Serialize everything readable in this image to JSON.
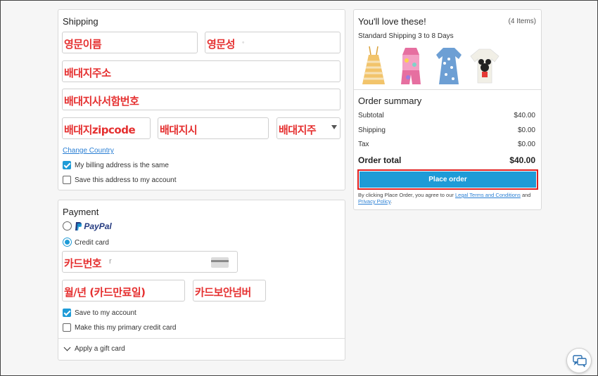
{
  "shipping": {
    "title": "Shipping",
    "first_name_overlay": "영문이름",
    "last_name_overlay": "영문성",
    "address_overlay": "배대지주소",
    "address2_overlay": "배대지사서함번호",
    "zip_overlay": "배대지zipcode",
    "city_overlay": "배대지시",
    "state_overlay": "배대지주",
    "change_country": "Change Country",
    "billing_same_label": "My billing address is the same",
    "billing_same_checked": true,
    "save_address_label": "Save this address to my account",
    "save_address_checked": false
  },
  "payment": {
    "title": "Payment",
    "paypal_label": "PayPal",
    "credit_card_label": "Credit card",
    "card_number_overlay": "카드번호",
    "card_number_placeholder_tail": "r",
    "expiry_overlay": "월/년 (카드만료일)",
    "cvv_overlay": "카드보안넘버",
    "save_account_label": "Save to my account",
    "save_account_checked": true,
    "primary_card_label": "Make this my primary credit card",
    "primary_card_checked": false,
    "gift_card_label": "Apply a gift card"
  },
  "cart": {
    "title": "You'll love these!",
    "items_count": "(4 Items)",
    "shipping_note": "Standard Shipping 3 to 8 Days",
    "products": [
      {
        "name": "striped-sundress",
        "color": "#f2c46b"
      },
      {
        "name": "floral-romper",
        "color": "#e66fa0"
      },
      {
        "name": "denim-polka-dress",
        "color": "#6d9fd4"
      },
      {
        "name": "minnie-tshirt",
        "color": "#f1efe6"
      }
    ]
  },
  "summary": {
    "title": "Order summary",
    "subtotal_label": "Subtotal",
    "subtotal_value": "$40.00",
    "shipping_label": "Shipping",
    "shipping_value": "$0.00",
    "tax_label": "Tax",
    "tax_value": "$0.00",
    "total_label": "Order total",
    "total_value": "$40.00",
    "place_order": "Place order",
    "terms_prefix": "By clicking Place Order, you agree to our",
    "terms_link": "Legal Terms and Conditions",
    "terms_and": "and",
    "privacy_link": "Privacy Policy",
    "terms_end": "."
  },
  "colors": {
    "accent": "#1e9bd7",
    "highlight_border": "#e02020",
    "overlay_text": "#e53030",
    "paypal_dark": "#253b80",
    "paypal_light": "#179bd7"
  },
  "icons": {
    "chat": "chat-bubbles-icon",
    "card": "credit-card-icon",
    "chevron": "chevron-down-icon"
  }
}
